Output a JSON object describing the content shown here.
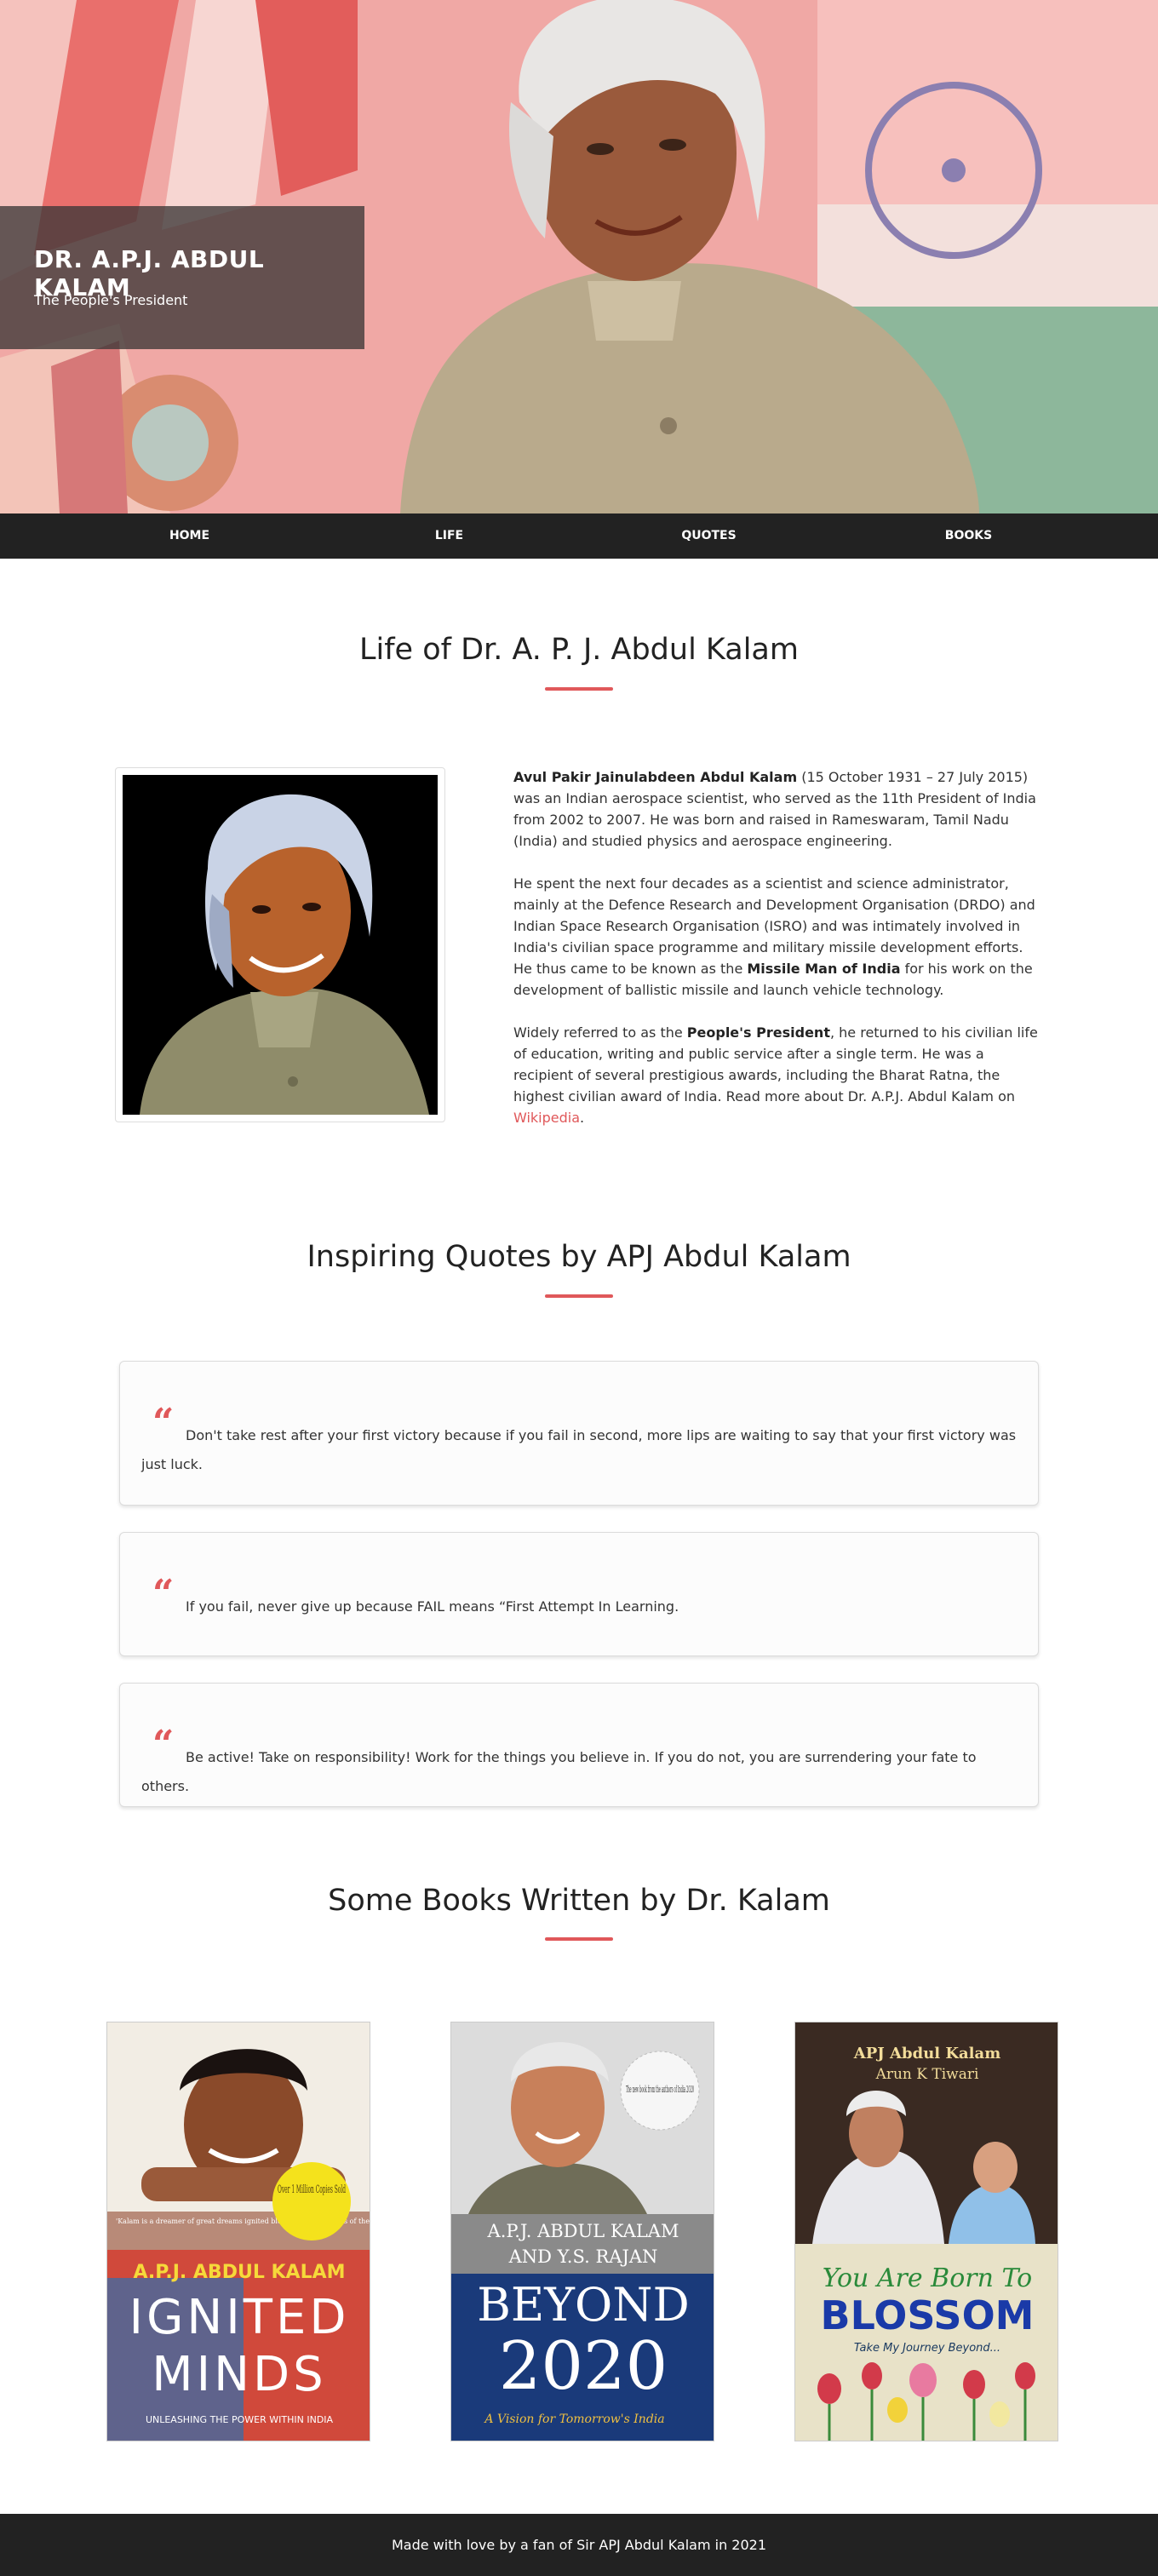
{
  "hero": {
    "title": "DR. A.P.J. ABDUL KALAM",
    "tagline": "The People's President"
  },
  "nav": {
    "items": [
      "HOME",
      "LIFE",
      "QUOTES",
      "BOOKS"
    ]
  },
  "life": {
    "heading": "Life of Dr. A. P. J. Abdul Kalam",
    "p1_bold": "Avul Pakir Jainulabdeen Abdul Kalam",
    "p1_rest": " (15 October 1931 – 27 July 2015) was an Indian aerospace scientist, who served as the 11th President of India from 2002 to 2007. He was born and raised in Rameswaram, Tamil Nadu (India) and studied physics and aerospace engineering.",
    "p2_pre": "He spent the next four decades as a scientist and science administrator, mainly at the Defence Research and Development Organisation (DRDO) and Indian Space Research Organisation (ISRO) and was intimately involved in India's civilian space programme and military missile development efforts. He thus came to be known as the ",
    "p2_bold": "Missile Man of India",
    "p2_post": " for his work on the development of ballistic missile and launch vehicle technology.",
    "p3_pre": "Widely referred to as the ",
    "p3_bold": "People's President",
    "p3_mid": ", he returned to his civilian life of education, writing and public service after a single term. He was a recipient of several prestigious awards, including the Bharat Ratna, the highest civilian award of India. Read more about Dr. A.P.J. Abdul Kalam on ",
    "p3_link": "Wikipedia",
    "p3_end": "."
  },
  "quotes": {
    "heading": "Inspiring Quotes by APJ Abdul Kalam",
    "mark": "“",
    "items": [
      "Don't take rest after your first victory because if you fail in second, more lips are waiting to say that your first victory was just luck.",
      "If you fail, never give up because FAIL means “First Attempt In Learning.",
      "Be active! Take on responsibility! Work for the things you believe in. If you do not, you are surrendering your fate to others."
    ]
  },
  "books": {
    "heading": "Some Books Written by Dr. Kalam",
    "b1": {
      "author": "A.P.J. ABDUL KALAM",
      "title1": "IGNITED",
      "title2": "MINDS",
      "subtitle": "UNLEASHING THE POWER WITHIN INDIA",
      "badge": "Over 1 Million Copies Sold",
      "blurb": "'Kalam is a dreamer of great dreams ignited blends with the minds of the young' — KHUSHWANT SINGH in Outlook"
    },
    "b2": {
      "sticker": "The new book from the authors of India 2020",
      "authors1": "A.P.J. ABDUL KALAM",
      "authors2": "AND Y.S. RAJAN",
      "title1": "BEYOND",
      "title2": "2020",
      "subtitle": "A Vision for Tomorrow's India"
    },
    "b3": {
      "author1": "APJ Abdul Kalam",
      "author2": "Arun K Tiwari",
      "title1": "You Are Born To",
      "title2": "BLOSSOM",
      "subtitle": "Take My Journey Beyond..."
    }
  },
  "footer": {
    "text": "Made with love by a fan of Sir APJ Abdul Kalam in 2021"
  }
}
